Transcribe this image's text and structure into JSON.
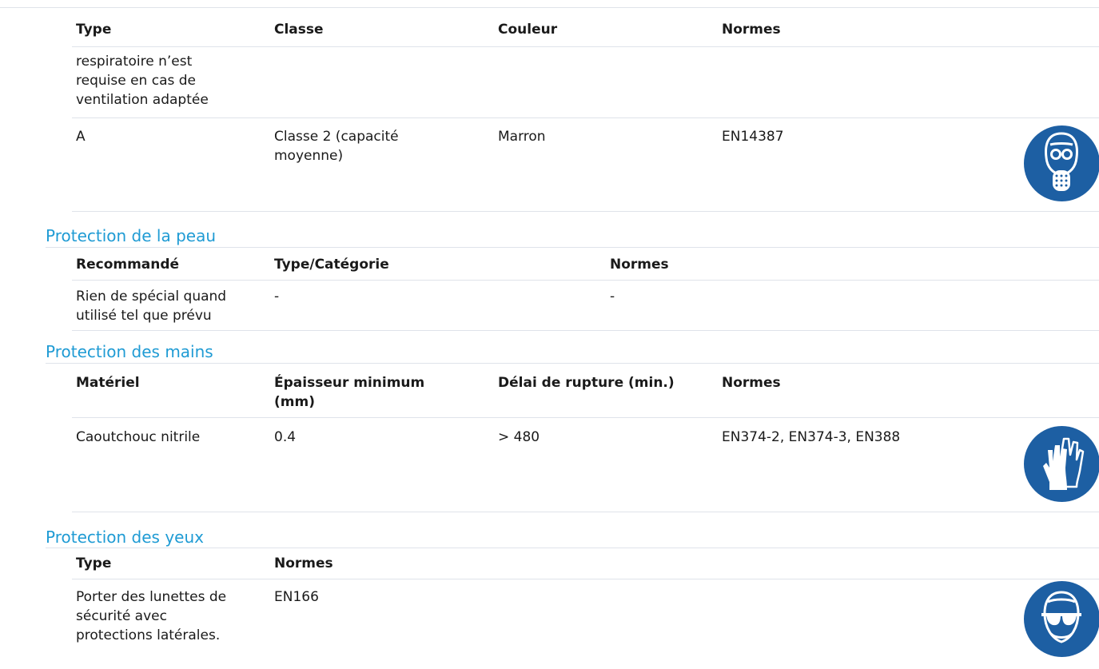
{
  "respiratory": {
    "headers": [
      "Type",
      "Classe",
      "Couleur",
      "Normes"
    ],
    "type_lines": [
      "respiratoire n’est",
      "requise en cas de",
      "ventilation adaptée"
    ],
    "row": {
      "type": "A",
      "class_lines": [
        "Classe 2 (capacité",
        "moyenne)"
      ],
      "color": "Marron",
      "norm": "EN14387"
    },
    "icon": "respirator-mask-icon"
  },
  "skin": {
    "title": "Protection de la peau",
    "headers": [
      "Recommandé",
      "Type/Catégorie",
      "Normes"
    ],
    "row": {
      "rec_lines": [
        "Rien de spécial quand",
        "utilisé tel que prévu"
      ],
      "type": "-",
      "norm": "-"
    }
  },
  "hands": {
    "title": "Protection des mains",
    "headers": [
      "Matériel",
      "Épaisseur minimum",
      "(mm)",
      "Délai de rupture (min.)",
      "Normes"
    ],
    "row": {
      "material": "Caoutchouc nitrile",
      "thickness": "0.4",
      "breakthrough": "> 480",
      "norms": "EN374-2, EN374-3, EN388"
    },
    "icon": "gloves-icon"
  },
  "eyes": {
    "title": "Protection des yeux",
    "headers": [
      "Type",
      "Normes"
    ],
    "row": {
      "type_lines": [
        "Porter des lunettes de",
        "sécurité avec",
        "protections latérales."
      ],
      "norm": "EN166"
    },
    "icon": "safety-glasses-icon"
  },
  "colors": {
    "accent": "#1f9bd4",
    "badge": "#1d5fa3",
    "rule": "#dfe3ea"
  }
}
